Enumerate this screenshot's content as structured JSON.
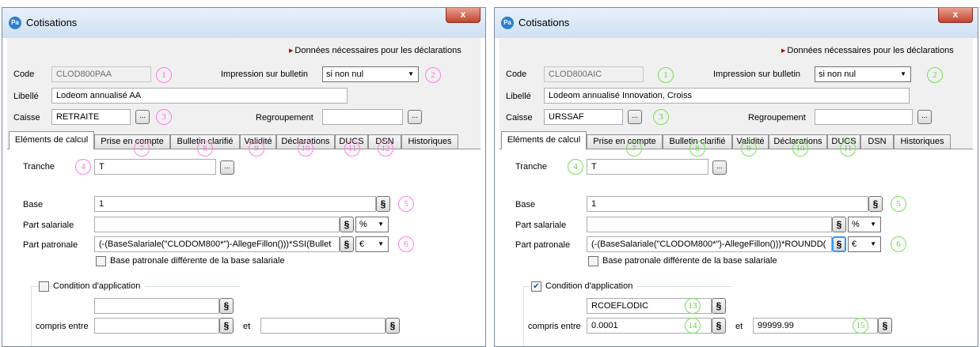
{
  "windows": [
    {
      "title": "Cotisations",
      "app_icon": "Pa",
      "close_glyph": "x",
      "declarations_link": "Données nécessaires pour les déclarations",
      "code_label": "Code",
      "code_value": "CLOD800PAA",
      "impression_label": "Impression sur bulletin",
      "impression_value": "si non nul",
      "libelle_label": "Libellé",
      "libelle_value": "Lodeom annualisé AA",
      "caisse_label": "Caisse",
      "caisse_value": "RETRAITE",
      "dots": "...",
      "regroupement_label": "Regroupement",
      "regroupement_value": "",
      "tabs": [
        "Eléments de calcul",
        "Prise en compte",
        "Bulletin clarifié",
        "Validité",
        "Déclarations",
        "DUCS",
        "DSN",
        "Historiques"
      ],
      "tranche_label": "Tranche",
      "tranche_value": "T",
      "base_label": "Base",
      "base_value": "1",
      "part_salariale_label": "Part salariale",
      "part_salariale_value": "",
      "part_salariale_unit": "%",
      "part_patronale_label": "Part patronale",
      "part_patronale_value": "(-(BaseSalariale(\"CLODOM800*\")-AllegeFillon()))*SSI(Bullet",
      "part_patronale_unit": "€",
      "s_glyph": "§",
      "base_diff_label": "Base patronale différente de la base salariale",
      "base_diff_checked": false,
      "condition_label": "Condition d'application",
      "condition_checked": false,
      "condition_value": "",
      "compris_label": "compris entre",
      "compris_min": "",
      "et_label": "et",
      "compris_max": "",
      "annotations": [
        "1",
        "2",
        "3",
        "4",
        "5",
        "6",
        "7",
        "8",
        "9",
        "10",
        "11",
        "12"
      ],
      "annotation_color": "#ff6fe0"
    },
    {
      "title": "Cotisations",
      "app_icon": "Pa",
      "close_glyph": "x",
      "declarations_link": "Données nécessaires pour les déclarations",
      "code_label": "Code",
      "code_value": "CLOD800AIC",
      "impression_label": "Impression sur bulletin",
      "impression_value": "si non nul",
      "libelle_label": "Libellé",
      "libelle_value": "Lodeom annualisé Innovation, Croiss",
      "caisse_label": "Caisse",
      "caisse_value": "URSSAF",
      "dots": "...",
      "regroupement_label": "Regroupement",
      "regroupement_value": "",
      "tabs": [
        "Eléments de calcul",
        "Prise en compte",
        "Bulletin clarifié",
        "Validité",
        "Déclarations",
        "DUCS",
        "DSN",
        "Historiques"
      ],
      "tranche_label": "Tranche",
      "tranche_value": "T",
      "base_label": "Base",
      "base_value": "1",
      "part_salariale_label": "Part salariale",
      "part_salariale_value": "",
      "part_salariale_unit": "%",
      "part_patronale_label": "Part patronale",
      "part_patronale_value": "(-(BaseSalariale(\"CLODOM800*\")-AllegeFillon()))*ROUNDD(",
      "part_patronale_unit": "€",
      "s_glyph": "§",
      "base_diff_label": "Base patronale différente de la base salariale",
      "base_diff_checked": false,
      "condition_label": "Condition d'application",
      "condition_checked": true,
      "condition_value": "RCOEFLODIC",
      "compris_label": "compris entre",
      "compris_min": "0.0001",
      "et_label": "et",
      "compris_max": "99999.99",
      "annotations": [
        "1",
        "2",
        "3",
        "4",
        "5",
        "6",
        "7",
        "8",
        "9",
        "10",
        "11",
        "13",
        "14",
        "15"
      ],
      "annotation_color": "#62d443"
    }
  ]
}
